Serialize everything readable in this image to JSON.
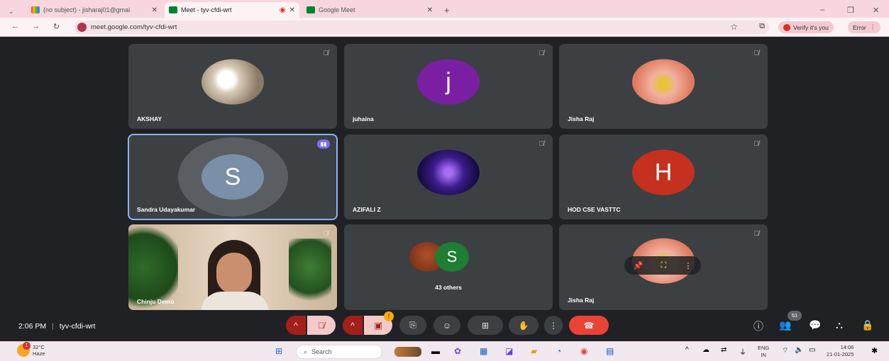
{
  "browser": {
    "tabs": [
      {
        "title": "(no subject) - jisharaj01@gmai"
      },
      {
        "title": "Meet - tyv-cfdi-wrt"
      },
      {
        "title": "Google Meet"
      }
    ],
    "url": "meet.google.com/tyv-cfdi-wrt",
    "verify_label": "Verify it's you",
    "error_label": "Error"
  },
  "participants": [
    {
      "name": "AKSHAY"
    },
    {
      "name": "juhaina",
      "initial": "j",
      "color": "#7b1fa2"
    },
    {
      "name": "Jisha Raj"
    },
    {
      "name": "Sandra Udayakumar",
      "initial": "S",
      "color": "#7a8fa8"
    },
    {
      "name": "AZIFALI Z"
    },
    {
      "name": "HOD CSE VASTTC",
      "initial": "H",
      "color": "#c5311e"
    },
    {
      "name": "Chinju Demo"
    },
    {
      "label": "43 others",
      "initial": "S",
      "color": "#1e7e34"
    },
    {
      "name": "Jisha Raj"
    }
  ],
  "meeting": {
    "time": "2:06 PM",
    "code": "tyv-cfdi-wrt",
    "people_count": "51",
    "camera_badge": "!"
  },
  "taskbar": {
    "weather_temp": "32°C",
    "weather_desc": "Haze",
    "weather_badge": "1",
    "search_placeholder": "Search",
    "lang_top": "ENG",
    "lang_bottom": "IN",
    "clock_time": "14:06",
    "clock_date": "21-01-2025"
  }
}
